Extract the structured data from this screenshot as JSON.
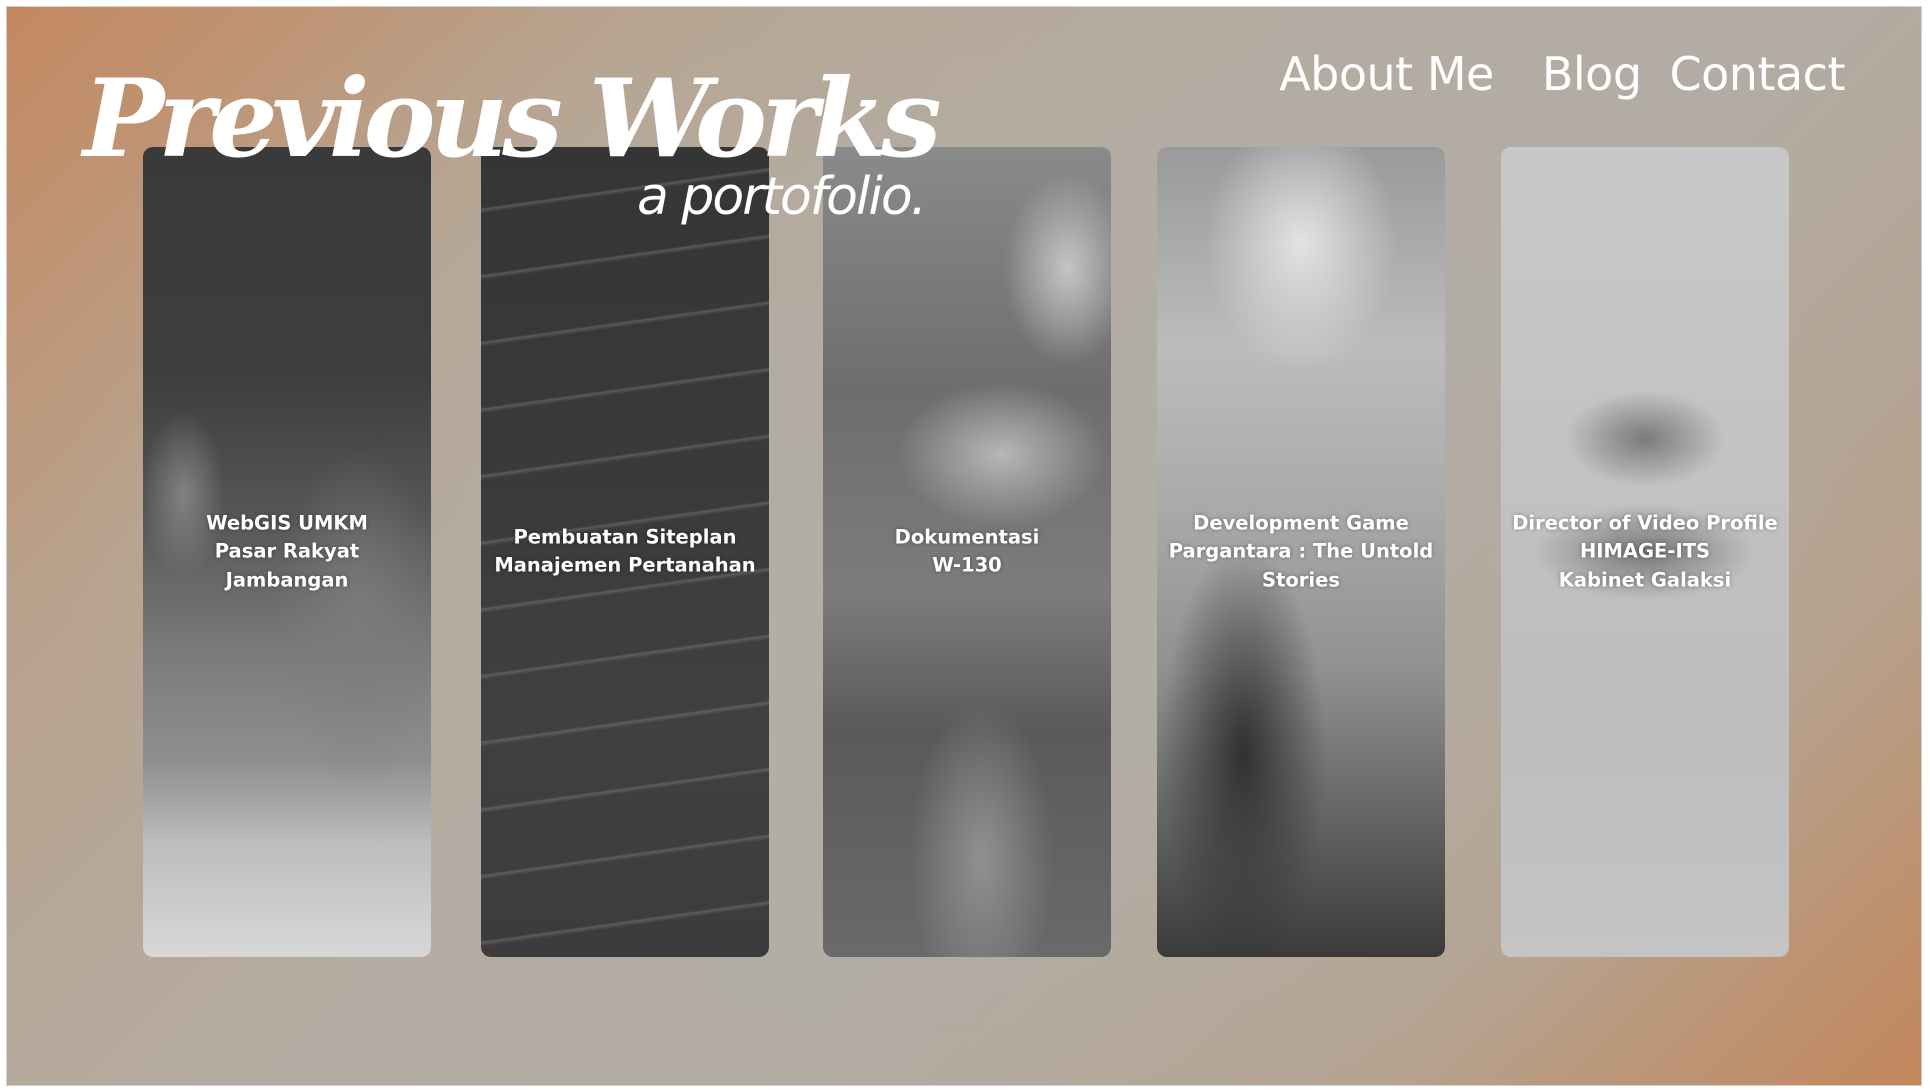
{
  "header": {
    "title": "Previous Works",
    "subtitle": "a portofolio."
  },
  "nav": {
    "items": [
      {
        "label": "About Me"
      },
      {
        "label": "Blog"
      },
      {
        "label": "Contact"
      }
    ]
  },
  "cards": [
    {
      "lines": [
        "WebGIS UMKM",
        "Pasar Rakyat Jambangan"
      ]
    },
    {
      "lines": [
        "Pembuatan Siteplan",
        "Manajemen Pertanahan"
      ]
    },
    {
      "lines": [
        "Dokumentasi",
        "W-130"
      ]
    },
    {
      "lines": [
        "Development Game",
        "Pargantara : The Untold",
        "Stories"
      ]
    },
    {
      "lines": [
        "Director of Video Profile",
        "HIMAGE-ITS",
        "Kabinet Galaksi"
      ]
    }
  ],
  "colors": {
    "accent_warm": "#c2875c",
    "background_mid": "#b2aca4",
    "text": "#ffffff"
  }
}
